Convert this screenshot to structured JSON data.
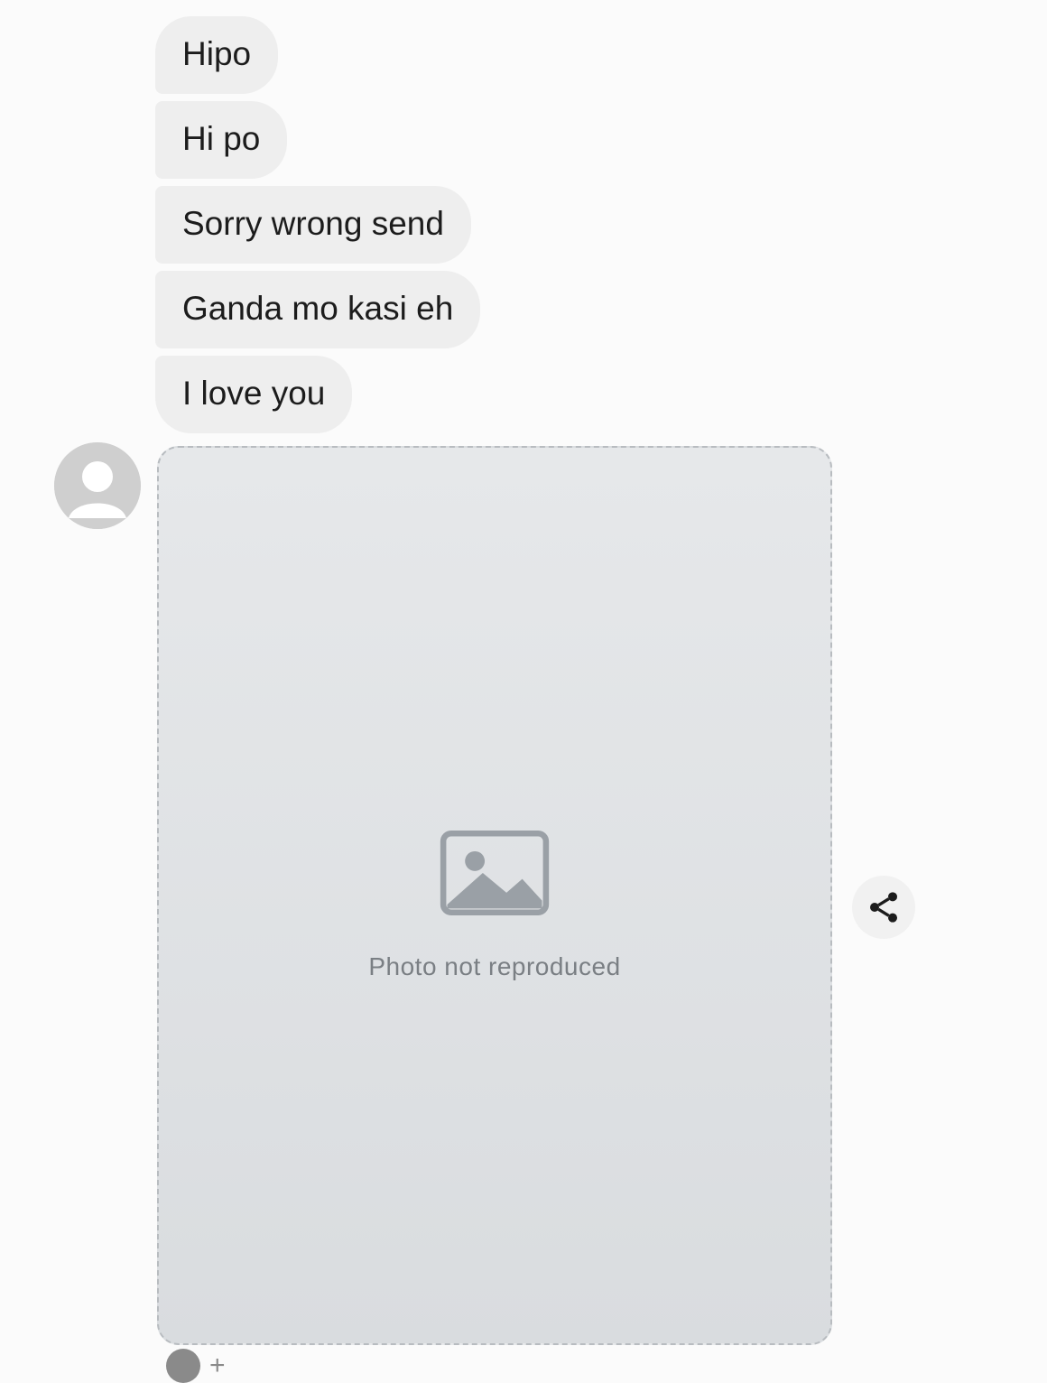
{
  "messages": [
    {
      "text": "Hipo"
    },
    {
      "text": "Hi po"
    },
    {
      "text": "Sorry wrong send"
    },
    {
      "text": "Ganda mo kasi eh"
    },
    {
      "text": "I love you"
    }
  ],
  "attachment": {
    "placeholder_caption": "Photo not reproduced"
  },
  "icons": {
    "avatar": "default-avatar-icon",
    "share": "share-icon",
    "reaction": "add-reaction-icon"
  },
  "colors": {
    "page_background": "#fbfbfb",
    "bubble_background": "#eeeeee",
    "bubble_text": "#1c1c1c",
    "avatar_background": "#cfcfcf",
    "icon_dark": "#1c1c1c"
  }
}
